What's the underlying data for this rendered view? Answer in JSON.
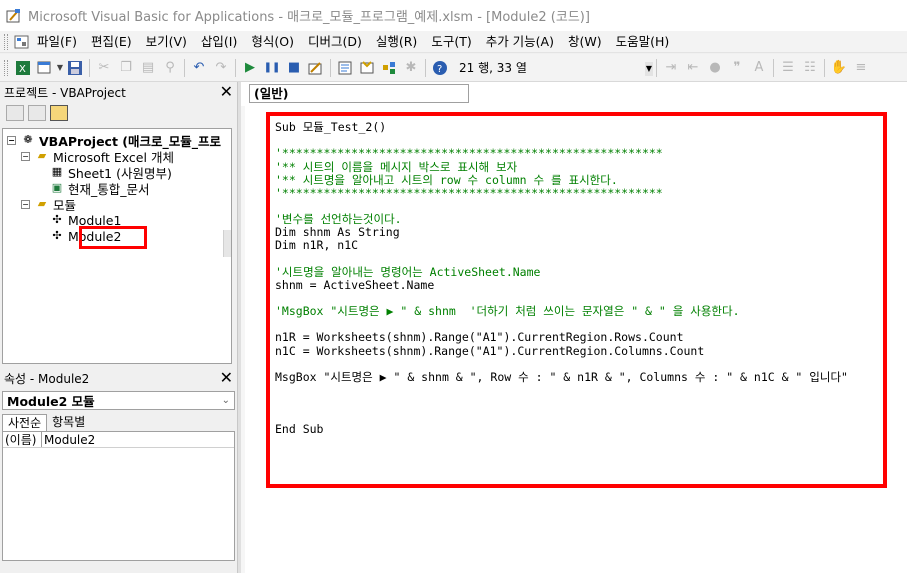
{
  "window": {
    "title": "Microsoft Visual Basic for Applications - 매크로_모듈_프로그램_예제.xlsm - [Module2 (코드)]"
  },
  "menubar": {
    "items": [
      "파일(F)",
      "편집(E)",
      "보기(V)",
      "삽입(I)",
      "형식(O)",
      "디버그(D)",
      "실행(R)",
      "도구(T)",
      "추가 기능(A)",
      "창(W)",
      "도움말(H)"
    ]
  },
  "toolbar": {
    "position": "21 행, 33 열"
  },
  "project_pane": {
    "title": "프로젝트 - VBAProject",
    "tree": {
      "root": "VBAProject (매크로_모듈_프로",
      "excel_objects": "Microsoft Excel 개체",
      "sheet1": "Sheet1 (사원명부)",
      "workbook": "현재_통합_문서",
      "modules_folder": "모듈",
      "module1": "Module1",
      "module2": "Module2"
    }
  },
  "properties_pane": {
    "title": "속성 - Module2",
    "selected_object": "Module2 모듈",
    "tabs": [
      "사전순",
      "항목별"
    ],
    "rows": [
      {
        "key": "(이름)",
        "value": "Module2"
      }
    ]
  },
  "code_window": {
    "procedure_combo": "(일반)",
    "lines": [
      {
        "text": "Sub 모듈_Test_2()",
        "style": "normal"
      },
      {
        "text": "",
        "style": "normal"
      },
      {
        "text": "'*******************************************************",
        "style": "comment"
      },
      {
        "text": "'** 시트의 이름을 메시지 박스로 표시해 보자",
        "style": "comment"
      },
      {
        "text": "'** 시트명을 알아내고 시트의 row 수 column 수 를 표시한다.",
        "style": "comment"
      },
      {
        "text": "'*******************************************************",
        "style": "comment"
      },
      {
        "text": "",
        "style": "normal"
      },
      {
        "text": "'변수를 선언하는것이다.",
        "style": "comment"
      },
      {
        "text": "Dim shnm As String",
        "style": "normal"
      },
      {
        "text": "Dim n1R, n1C",
        "style": "normal"
      },
      {
        "text": "",
        "style": "normal"
      },
      {
        "text": "'시트명을 알아내는 명령어는 ActiveSheet.Name",
        "style": "comment"
      },
      {
        "text": "shnm = ActiveSheet.Name",
        "style": "normal"
      },
      {
        "text": "",
        "style": "normal"
      },
      {
        "text": "'MsgBox \"시트명은 ▶ \" & shnm  '더하기 처럼 쓰이는 문자열은 \" & \" 을 사용한다.",
        "style": "comment"
      },
      {
        "text": "",
        "style": "normal"
      },
      {
        "text": "n1R = Worksheets(shnm).Range(\"A1\").CurrentRegion.Rows.Count",
        "style": "normal"
      },
      {
        "text": "n1C = Worksheets(shnm).Range(\"A1\").CurrentRegion.Columns.Count",
        "style": "normal"
      },
      {
        "text": "",
        "style": "normal"
      },
      {
        "text": "MsgBox \"시트명은 ▶ \" & shnm & \", Row 수 : \" & n1R & \", Columns 수 : \" & n1C & \" 입니다\"",
        "style": "normal"
      },
      {
        "text": "",
        "style": "normal"
      },
      {
        "text": "",
        "style": "normal"
      },
      {
        "text": "",
        "style": "normal"
      },
      {
        "text": "End Sub",
        "style": "normal"
      }
    ]
  },
  "colors": {
    "highlight": "#ff0000",
    "comment": "#008000",
    "background": "#f0f0f0"
  }
}
